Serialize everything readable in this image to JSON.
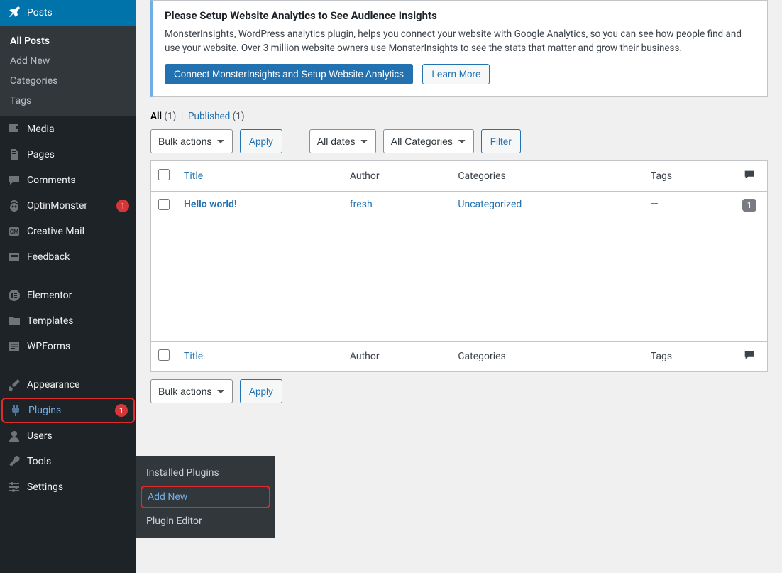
{
  "sidebar": {
    "posts": {
      "label": "Posts",
      "submenu": [
        "All Posts",
        "Add New",
        "Categories",
        "Tags"
      ]
    },
    "media": "Media",
    "pages": "Pages",
    "comments": "Comments",
    "optinmonster": {
      "label": "OptinMonster",
      "badge": "1"
    },
    "creativemail": "Creative Mail",
    "feedback": "Feedback",
    "elementor": "Elementor",
    "templates": "Templates",
    "wpforms": "WPForms",
    "appearance": "Appearance",
    "plugins": {
      "label": "Plugins",
      "badge": "1",
      "flyout": [
        "Installed Plugins",
        "Add New",
        "Plugin Editor"
      ]
    },
    "users": "Users",
    "tools": "Tools",
    "settings": "Settings"
  },
  "notice": {
    "title": "Please Setup Website Analytics to See Audience Insights",
    "body": "MonsterInsights, WordPress analytics plugin, helps you connect your website with Google Analytics, so you can see how people find and use your website. Over 3 million website owners use MonsterInsights to see the stats that matter and grow their business.",
    "primary_btn": "Connect MonsterInsights and Setup Website Analytics",
    "secondary_btn": "Learn More"
  },
  "filters": {
    "all_label": "All",
    "all_count": "(1)",
    "published_label": "Published",
    "published_count": "(1)"
  },
  "toolbar": {
    "bulk": "Bulk actions",
    "apply": "Apply",
    "dates": "All dates",
    "cats": "All Categories",
    "filter": "Filter"
  },
  "table": {
    "cols": {
      "title": "Title",
      "author": "Author",
      "categories": "Categories",
      "tags": "Tags"
    },
    "row": {
      "title": "Hello world!",
      "author": "fresh",
      "categories": "Uncategorized",
      "tags": "—",
      "comments": "1"
    }
  }
}
